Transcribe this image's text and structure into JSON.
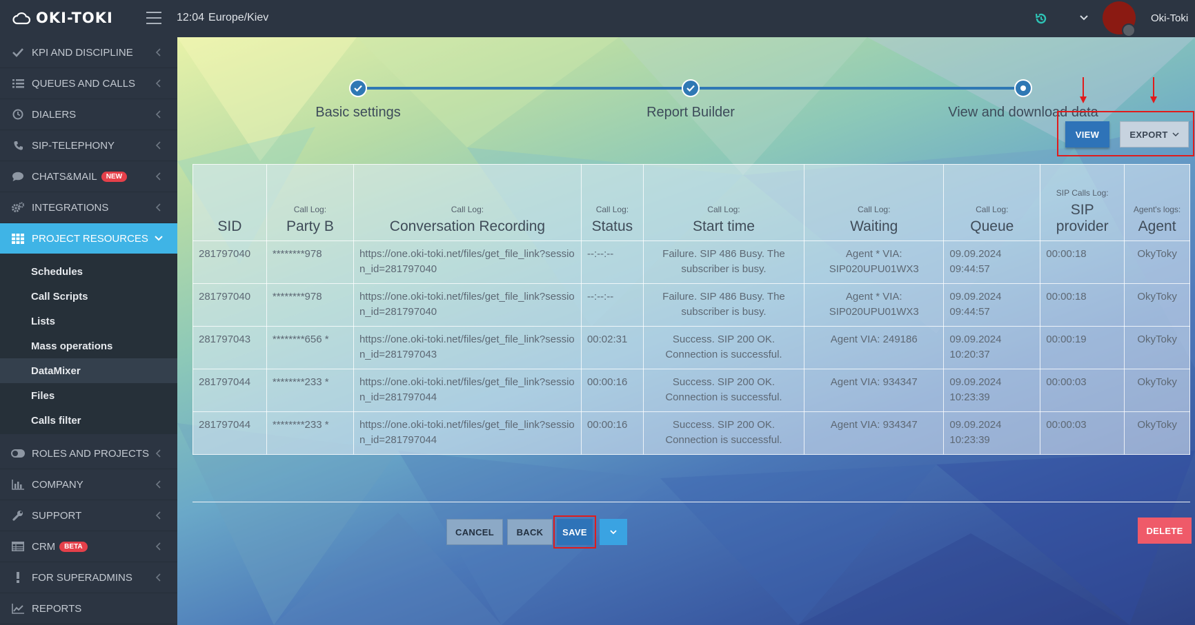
{
  "app": {
    "brand": "OKI-TOKI",
    "time": "12:04",
    "timezone": "Europe/Kiev",
    "username": "Oki-Toki"
  },
  "sidebar": {
    "items": [
      {
        "label": "KPI AND DISCIPLINE",
        "icon": "check-icon"
      },
      {
        "label": "QUEUES AND CALLS",
        "icon": "list-icon"
      },
      {
        "label": "DIALERS",
        "icon": "clock-icon"
      },
      {
        "label": "SIP-TELEPHONY",
        "icon": "phone-icon"
      },
      {
        "label": "CHATS&MAIL",
        "icon": "chat-icon",
        "badge": "NEW"
      },
      {
        "label": "INTEGRATIONS",
        "icon": "cogs-icon"
      },
      {
        "label": "PROJECT RESOURCES",
        "icon": "grid-icon",
        "active": true
      },
      {
        "label": "ROLES AND PROJECTS",
        "icon": "toggle-icon"
      },
      {
        "label": "COMPANY",
        "icon": "bar-chart-icon"
      },
      {
        "label": "SUPPORT",
        "icon": "wrench-icon"
      },
      {
        "label": "CRM",
        "icon": "table-icon",
        "badge": "BETA"
      },
      {
        "label": "FOR SUPERADMINS",
        "icon": "exclamation-icon"
      },
      {
        "label": "REPORTS",
        "icon": "line-chart-icon"
      }
    ],
    "subitems": [
      "Schedules",
      "Call Scripts",
      "Lists",
      "Mass operations",
      "DataMixer",
      "Files",
      "Calls filter"
    ]
  },
  "wizard": {
    "steps": [
      "Basic settings",
      "Report Builder",
      "View and download data"
    ]
  },
  "actions": {
    "view": "VIEW",
    "export": "EXPORT"
  },
  "table": {
    "headers": [
      {
        "pre": "",
        "main": "SID"
      },
      {
        "pre": "Call Log:",
        "main": "Party B"
      },
      {
        "pre": "Call Log:",
        "main": "Conversation Recording"
      },
      {
        "pre": "Call Log:",
        "main": "Status"
      },
      {
        "pre": "Call Log:",
        "main": "Start time"
      },
      {
        "pre": "Call Log:",
        "main": "Waiting"
      },
      {
        "pre": "Call Log:",
        "main": "Queue"
      },
      {
        "pre": "SIP Calls Log:",
        "main": "SIP provider"
      },
      {
        "pre": "Agent's logs:",
        "main": "Agent"
      }
    ],
    "rows": [
      [
        "281797040",
        "********978",
        "https://one.oki-toki.net/files/get_file_link?session_id=281797040",
        "--:--:--",
        "Failure. SIP 486 Busy. The subscriber is busy.",
        "Agent * VIA: SIP020UPU01WX3",
        "09.09.2024 09:44:57",
        "00:00:18",
        "OkyToky"
      ],
      [
        "281797040",
        "********978",
        "https://one.oki-toki.net/files/get_file_link?session_id=281797040",
        "--:--:--",
        "Failure. SIP 486 Busy. The subscriber is busy.",
        "Agent * VIA: SIP020UPU01WX3",
        "09.09.2024 09:44:57",
        "00:00:18",
        "OkyToky"
      ],
      [
        "281797043",
        "********656 *",
        "https://one.oki-toki.net/files/get_file_link?session_id=281797043",
        "00:02:31",
        "Success. SIP 200 OK. Connection is successful.",
        "Agent VIA: 249186",
        "09.09.2024 10:20:37",
        "00:00:19",
        "OkyToky"
      ],
      [
        "281797044",
        "********233 *",
        "https://one.oki-toki.net/files/get_file_link?session_id=281797044",
        "00:00:16",
        "Success. SIP 200 OK. Connection is successful.",
        "Agent VIA: 934347",
        "09.09.2024 10:23:39",
        "00:00:03",
        "OkyToky"
      ],
      [
        "281797044",
        "********233 *",
        "https://one.oki-toki.net/files/get_file_link?session_id=281797044",
        "00:00:16",
        "Success. SIP 200 OK. Connection is successful.",
        "Agent VIA: 934347",
        "09.09.2024 10:23:39",
        "00:00:03",
        "OkyToky"
      ]
    ]
  },
  "footer": {
    "cancel": "CANCEL",
    "back": "BACK",
    "save": "SAVE",
    "delete": "DELETE"
  },
  "colors": {
    "accent": "#3fb4e6",
    "primary": "#2e73b8",
    "danger": "#ef5a69",
    "highlight": "#e01b1b"
  }
}
